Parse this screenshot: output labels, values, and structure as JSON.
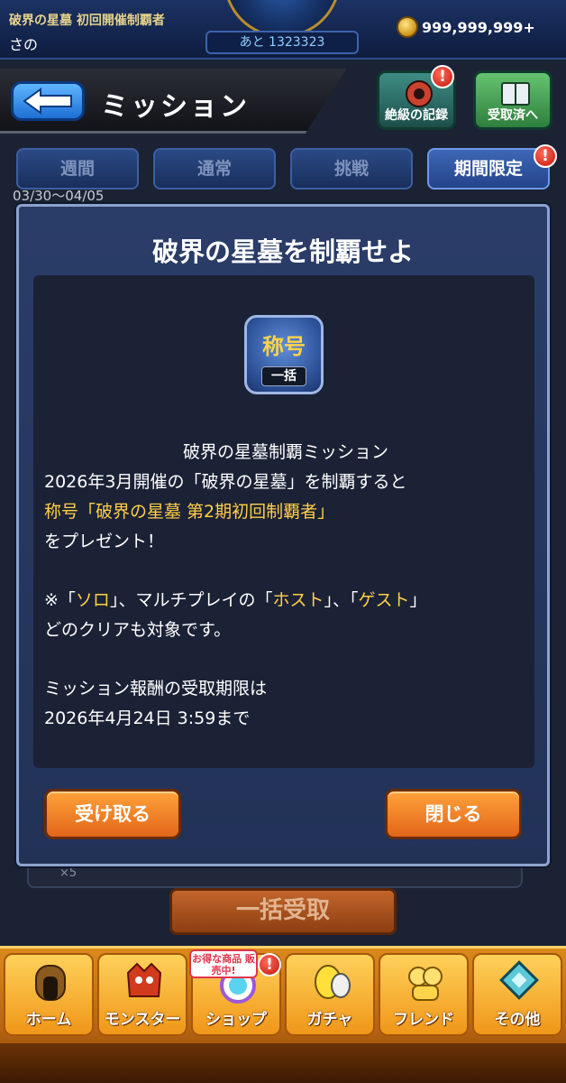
{
  "status": {
    "title": "破界の星墓 初回開催制覇者",
    "player": "さの",
    "remaining": "あと 1323323",
    "coins": "999,999,999+"
  },
  "header": {
    "title": "ミッション",
    "record_label": "絶級の記録",
    "received_label": "受取済へ"
  },
  "tabs": [
    {
      "label": "週間"
    },
    {
      "label": "通常"
    },
    {
      "label": "挑戦"
    },
    {
      "label": "期間限定"
    }
  ],
  "date_range": "03/30〜04/05",
  "modal": {
    "title": "破界の星墓を制覇せよ",
    "badge_main": "称号",
    "badge_sub": "一括",
    "desc_heading": "破界の星墓制覇ミッション",
    "desc_line1": "2026年3月開催の「破界の星墓」を制覇すると",
    "desc_line2": "称号「破界の星墓 第2期初回制覇者」",
    "desc_line3": "をプレゼント！",
    "note_prefix": "※「",
    "note_solo": "ソロ",
    "note_mid1": "」、マルチプレイの「",
    "note_host": "ホスト",
    "note_mid2": "」、「",
    "note_guest": "ゲスト",
    "note_suffix": "」",
    "note_line2": "どのクリアも対象です。",
    "deadline_line1": "ミッション報酬の受取期限は",
    "deadline_line2": "2026年4月24日 3:59まで",
    "receive_label": "受け取る",
    "close_label": "閉じる"
  },
  "background": {
    "count": "×5",
    "bulk_label": "一括受取"
  },
  "nav": {
    "sale_tag": "お得な商品 販売中!",
    "items": [
      {
        "label": "ホーム",
        "icon": "home-icon"
      },
      {
        "label": "モンスター",
        "icon": "monster-icon"
      },
      {
        "label": "ショップ",
        "icon": "shop-icon"
      },
      {
        "label": "ガチャ",
        "icon": "gacha-icon"
      },
      {
        "label": "フレンド",
        "icon": "friend-icon"
      },
      {
        "label": "その他",
        "icon": "other-icon"
      }
    ]
  },
  "colors": {
    "accent_yellow": "#ffcf47",
    "button_orange": "#f08a28",
    "modal_bg": "#2a3d68"
  }
}
